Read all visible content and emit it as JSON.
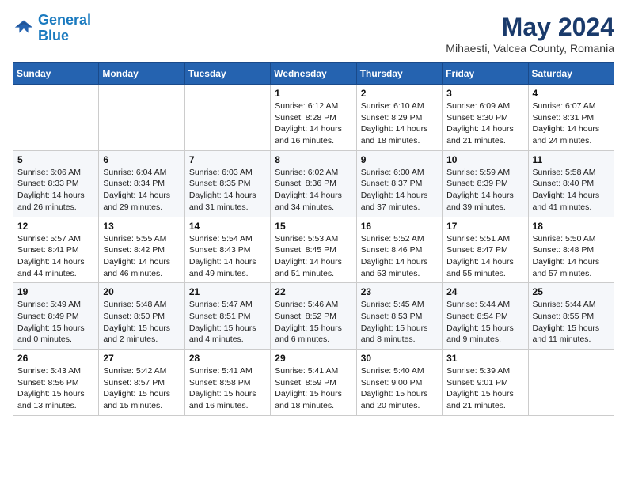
{
  "header": {
    "logo_line1": "General",
    "logo_line2": "Blue",
    "month": "May 2024",
    "location": "Mihaesti, Valcea County, Romania"
  },
  "weekdays": [
    "Sunday",
    "Monday",
    "Tuesday",
    "Wednesday",
    "Thursday",
    "Friday",
    "Saturday"
  ],
  "weeks": [
    [
      {
        "day": "",
        "info": ""
      },
      {
        "day": "",
        "info": ""
      },
      {
        "day": "",
        "info": ""
      },
      {
        "day": "1",
        "info": "Sunrise: 6:12 AM\nSunset: 8:28 PM\nDaylight: 14 hours\nand 16 minutes."
      },
      {
        "day": "2",
        "info": "Sunrise: 6:10 AM\nSunset: 8:29 PM\nDaylight: 14 hours\nand 18 minutes."
      },
      {
        "day": "3",
        "info": "Sunrise: 6:09 AM\nSunset: 8:30 PM\nDaylight: 14 hours\nand 21 minutes."
      },
      {
        "day": "4",
        "info": "Sunrise: 6:07 AM\nSunset: 8:31 PM\nDaylight: 14 hours\nand 24 minutes."
      }
    ],
    [
      {
        "day": "5",
        "info": "Sunrise: 6:06 AM\nSunset: 8:33 PM\nDaylight: 14 hours\nand 26 minutes."
      },
      {
        "day": "6",
        "info": "Sunrise: 6:04 AM\nSunset: 8:34 PM\nDaylight: 14 hours\nand 29 minutes."
      },
      {
        "day": "7",
        "info": "Sunrise: 6:03 AM\nSunset: 8:35 PM\nDaylight: 14 hours\nand 31 minutes."
      },
      {
        "day": "8",
        "info": "Sunrise: 6:02 AM\nSunset: 8:36 PM\nDaylight: 14 hours\nand 34 minutes."
      },
      {
        "day": "9",
        "info": "Sunrise: 6:00 AM\nSunset: 8:37 PM\nDaylight: 14 hours\nand 37 minutes."
      },
      {
        "day": "10",
        "info": "Sunrise: 5:59 AM\nSunset: 8:39 PM\nDaylight: 14 hours\nand 39 minutes."
      },
      {
        "day": "11",
        "info": "Sunrise: 5:58 AM\nSunset: 8:40 PM\nDaylight: 14 hours\nand 41 minutes."
      }
    ],
    [
      {
        "day": "12",
        "info": "Sunrise: 5:57 AM\nSunset: 8:41 PM\nDaylight: 14 hours\nand 44 minutes."
      },
      {
        "day": "13",
        "info": "Sunrise: 5:55 AM\nSunset: 8:42 PM\nDaylight: 14 hours\nand 46 minutes."
      },
      {
        "day": "14",
        "info": "Sunrise: 5:54 AM\nSunset: 8:43 PM\nDaylight: 14 hours\nand 49 minutes."
      },
      {
        "day": "15",
        "info": "Sunrise: 5:53 AM\nSunset: 8:45 PM\nDaylight: 14 hours\nand 51 minutes."
      },
      {
        "day": "16",
        "info": "Sunrise: 5:52 AM\nSunset: 8:46 PM\nDaylight: 14 hours\nand 53 minutes."
      },
      {
        "day": "17",
        "info": "Sunrise: 5:51 AM\nSunset: 8:47 PM\nDaylight: 14 hours\nand 55 minutes."
      },
      {
        "day": "18",
        "info": "Sunrise: 5:50 AM\nSunset: 8:48 PM\nDaylight: 14 hours\nand 57 minutes."
      }
    ],
    [
      {
        "day": "19",
        "info": "Sunrise: 5:49 AM\nSunset: 8:49 PM\nDaylight: 15 hours\nand 0 minutes."
      },
      {
        "day": "20",
        "info": "Sunrise: 5:48 AM\nSunset: 8:50 PM\nDaylight: 15 hours\nand 2 minutes."
      },
      {
        "day": "21",
        "info": "Sunrise: 5:47 AM\nSunset: 8:51 PM\nDaylight: 15 hours\nand 4 minutes."
      },
      {
        "day": "22",
        "info": "Sunrise: 5:46 AM\nSunset: 8:52 PM\nDaylight: 15 hours\nand 6 minutes."
      },
      {
        "day": "23",
        "info": "Sunrise: 5:45 AM\nSunset: 8:53 PM\nDaylight: 15 hours\nand 8 minutes."
      },
      {
        "day": "24",
        "info": "Sunrise: 5:44 AM\nSunset: 8:54 PM\nDaylight: 15 hours\nand 9 minutes."
      },
      {
        "day": "25",
        "info": "Sunrise: 5:44 AM\nSunset: 8:55 PM\nDaylight: 15 hours\nand 11 minutes."
      }
    ],
    [
      {
        "day": "26",
        "info": "Sunrise: 5:43 AM\nSunset: 8:56 PM\nDaylight: 15 hours\nand 13 minutes."
      },
      {
        "day": "27",
        "info": "Sunrise: 5:42 AM\nSunset: 8:57 PM\nDaylight: 15 hours\nand 15 minutes."
      },
      {
        "day": "28",
        "info": "Sunrise: 5:41 AM\nSunset: 8:58 PM\nDaylight: 15 hours\nand 16 minutes."
      },
      {
        "day": "29",
        "info": "Sunrise: 5:41 AM\nSunset: 8:59 PM\nDaylight: 15 hours\nand 18 minutes."
      },
      {
        "day": "30",
        "info": "Sunrise: 5:40 AM\nSunset: 9:00 PM\nDaylight: 15 hours\nand 20 minutes."
      },
      {
        "day": "31",
        "info": "Sunrise: 5:39 AM\nSunset: 9:01 PM\nDaylight: 15 hours\nand 21 minutes."
      },
      {
        "day": "",
        "info": ""
      }
    ]
  ]
}
